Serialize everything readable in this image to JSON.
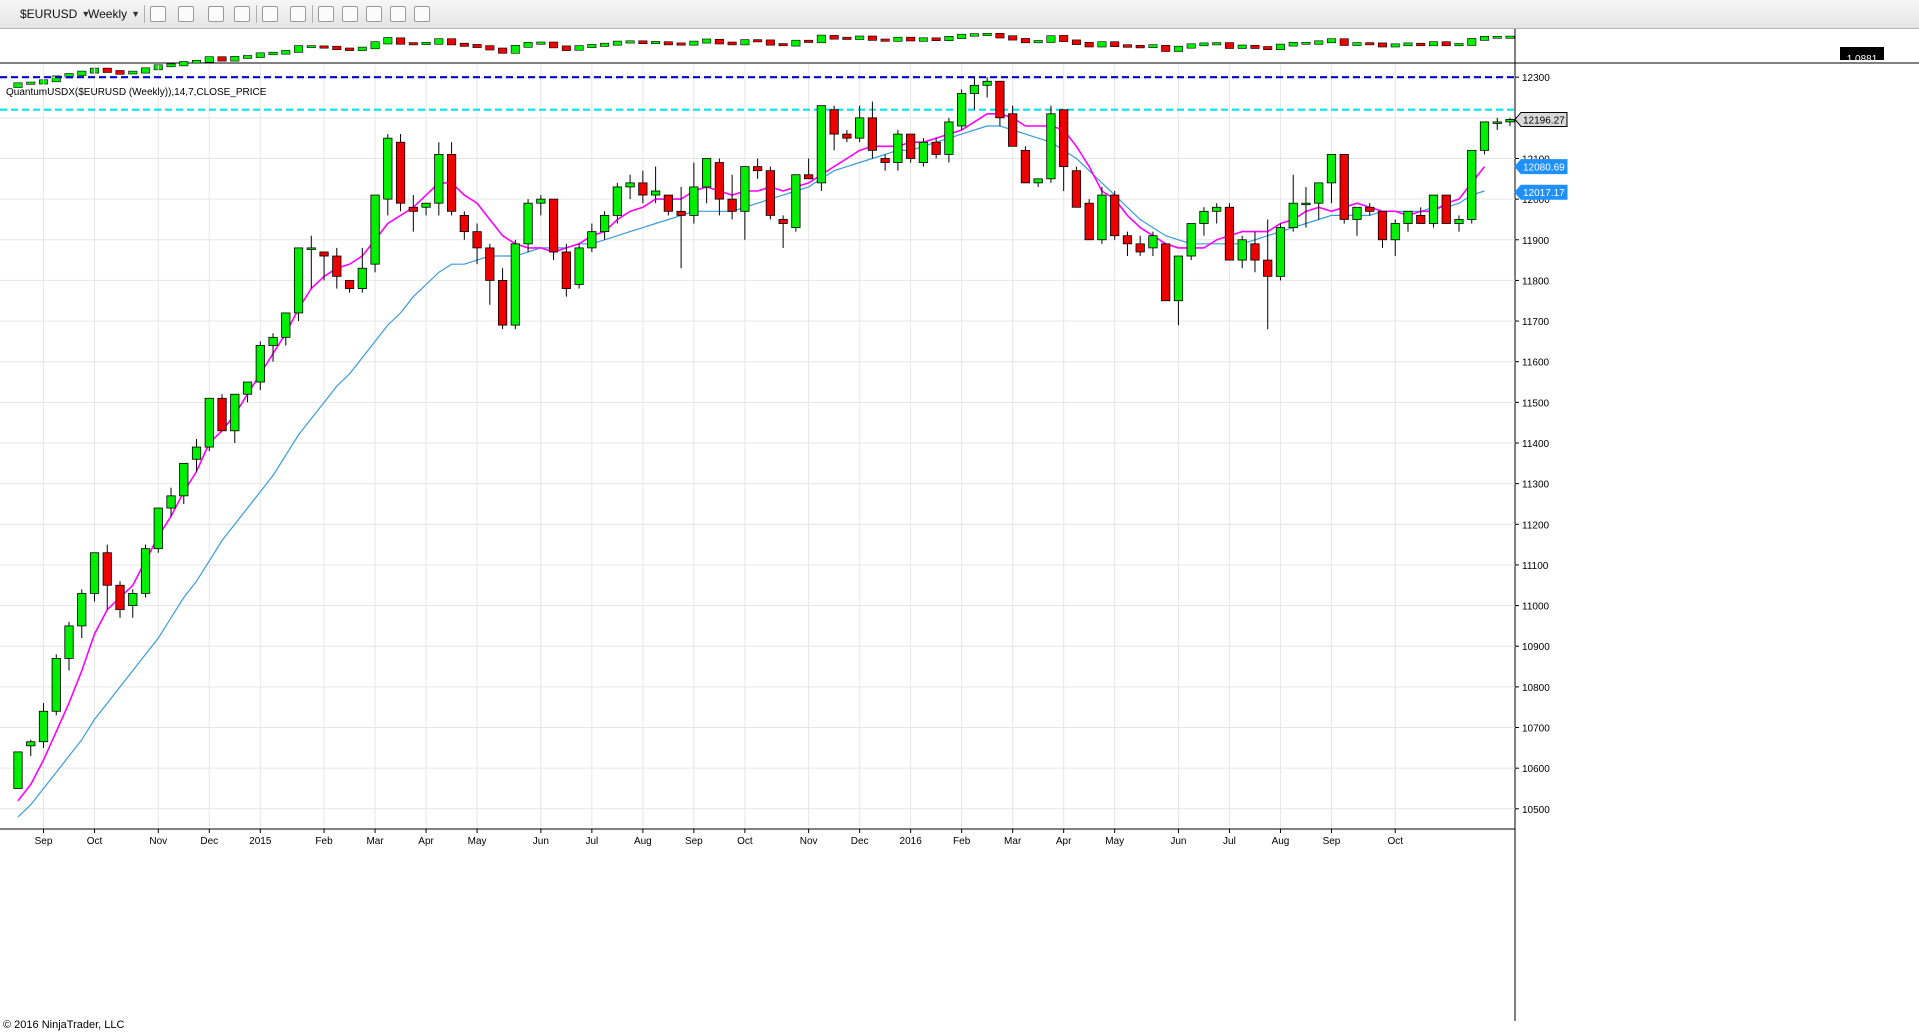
{
  "toolbar": {
    "instrument": "$EURUSD",
    "period": "Weekly"
  },
  "overview": {
    "price_badge": "1.0881"
  },
  "indicator_label": "QuantumUSDX($EURUSD (Weekly)),14,7,CLOSE_PRICE",
  "copyright": "© 2016 NinjaTrader, LLC",
  "colors": {
    "up": "#00ee00",
    "down": "#ee0000",
    "ema_fast": "#ff00ff",
    "ema_slow": "#3a9bdc",
    "resistance_1": "#0000cc",
    "resistance_2": "#00e5ee",
    "price_tag": "#1e90ff"
  },
  "chart_data": {
    "type": "candlestick",
    "ylim": [
      10470,
      12330
    ],
    "y_ticks": [
      "12300",
      "12200",
      "12100",
      "12000",
      "11900",
      "11800",
      "11700",
      "11600",
      "11500",
      "11400",
      "11300",
      "11200",
      "11100",
      "11000",
      "10900",
      "10800",
      "10700",
      "10600",
      "10500"
    ],
    "x_labels": [
      "Sep",
      "Oct",
      "Nov",
      "Dec",
      "2015",
      "Feb",
      "Mar",
      "Apr",
      "May",
      "Jun",
      "Jul",
      "Aug",
      "Sep",
      "Oct",
      "Nov",
      "Dec",
      "2016",
      "Feb",
      "Mar",
      "Apr",
      "May",
      "Jun",
      "Jul",
      "Aug",
      "Sep",
      "Oct"
    ],
    "x_label_bars": [
      2,
      6,
      11,
      15,
      19,
      24,
      28,
      32,
      36,
      41,
      45,
      49,
      53,
      57,
      62,
      66,
      70,
      74,
      78,
      82,
      86,
      91,
      95,
      99,
      103,
      108
    ],
    "resistance_levels": [
      12300,
      12220
    ],
    "price_tags": [
      {
        "label": "12196.27",
        "value": 12196,
        "style": "current"
      },
      {
        "label": "12080.69",
        "value": 12080,
        "style": "blue"
      },
      {
        "label": "12017.17",
        "value": 12017,
        "style": "blue"
      }
    ],
    "candles": [
      [
        10550,
        10640,
        10550,
        10640
      ],
      [
        10655,
        10670,
        10630,
        10665
      ],
      [
        10665,
        10760,
        10650,
        10740
      ],
      [
        10740,
        10880,
        10730,
        10870
      ],
      [
        10870,
        10960,
        10840,
        10950
      ],
      [
        10950,
        11040,
        10920,
        11030
      ],
      [
        11030,
        11130,
        11010,
        11130
      ],
      [
        11130,
        11150,
        10990,
        11050
      ],
      [
        11050,
        11060,
        10970,
        10990
      ],
      [
        11000,
        11040,
        10970,
        11030
      ],
      [
        11030,
        11150,
        11020,
        11140
      ],
      [
        11140,
        11240,
        11130,
        11240
      ],
      [
        11240,
        11290,
        11220,
        11270
      ],
      [
        11270,
        11340,
        11250,
        11350
      ],
      [
        11360,
        11410,
        11330,
        11390
      ],
      [
        11390,
        11510,
        11380,
        11510
      ],
      [
        11510,
        11520,
        11430,
        11430
      ],
      [
        11430,
        11520,
        11400,
        11520
      ],
      [
        11520,
        11550,
        11500,
        11550
      ],
      [
        11550,
        11650,
        11530,
        11640
      ],
      [
        11640,
        11670,
        11600,
        11660
      ],
      [
        11660,
        11720,
        11640,
        11720
      ],
      [
        11720,
        11880,
        11700,
        11880
      ],
      [
        11880,
        11910,
        11780,
        11880
      ],
      [
        11870,
        11870,
        11800,
        11860
      ],
      [
        11860,
        11880,
        11780,
        11810
      ],
      [
        11800,
        11800,
        11770,
        11780
      ],
      [
        11780,
        11880,
        11770,
        11830
      ],
      [
        11840,
        12010,
        11820,
        12010
      ],
      [
        12000,
        12160,
        11960,
        12150
      ],
      [
        12140,
        12160,
        11970,
        11990
      ],
      [
        11980,
        12010,
        11920,
        11970
      ],
      [
        11980,
        11990,
        11960,
        11990
      ],
      [
        11990,
        12140,
        11960,
        12110
      ],
      [
        12110,
        12140,
        11960,
        11970
      ],
      [
        11960,
        11970,
        11900,
        11920
      ],
      [
        11920,
        11940,
        11840,
        11880
      ],
      [
        11880,
        11890,
        11740,
        11800
      ],
      [
        11800,
        11830,
        11680,
        11690
      ],
      [
        11690,
        11900,
        11680,
        11890
      ],
      [
        11890,
        12000,
        11870,
        11990
      ],
      [
        11990,
        12010,
        11960,
        12000
      ],
      [
        12000,
        12000,
        11850,
        11870
      ],
      [
        11870,
        11890,
        11760,
        11780
      ],
      [
        11790,
        11890,
        11780,
        11880
      ],
      [
        11880,
        11940,
        11870,
        11920
      ],
      [
        11920,
        11970,
        11900,
        11960
      ],
      [
        11960,
        12040,
        11940,
        12030
      ],
      [
        12030,
        12060,
        12000,
        12040
      ],
      [
        12040,
        12070,
        11990,
        12010
      ],
      [
        12010,
        12080,
        11990,
        12020
      ],
      [
        12010,
        12010,
        11960,
        11970
      ],
      [
        11970,
        12030,
        11830,
        11960
      ],
      [
        11960,
        12090,
        11940,
        12030
      ],
      [
        12030,
        12090,
        11990,
        12100
      ],
      [
        12090,
        12100,
        11960,
        12000
      ],
      [
        12000,
        12060,
        11950,
        11970
      ],
      [
        11970,
        12080,
        11900,
        12080
      ],
      [
        12080,
        12100,
        12050,
        12070
      ],
      [
        12070,
        12080,
        11950,
        11960
      ],
      [
        11950,
        11960,
        11880,
        11940
      ],
      [
        11930,
        12050,
        11920,
        12060
      ],
      [
        12060,
        12100,
        12050,
        12050
      ],
      [
        12040,
        12230,
        12020,
        12230
      ],
      [
        12220,
        12230,
        12120,
        12160
      ],
      [
        12160,
        12170,
        12140,
        12150
      ],
      [
        12150,
        12230,
        12140,
        12200
      ],
      [
        12200,
        12240,
        12100,
        12120
      ],
      [
        12100,
        12110,
        12070,
        12090
      ],
      [
        12090,
        12170,
        12070,
        12160
      ],
      [
        12160,
        12160,
        12090,
        12100
      ],
      [
        12090,
        12150,
        12080,
        12140
      ],
      [
        12140,
        12150,
        12100,
        12110
      ],
      [
        12110,
        12200,
        12090,
        12190
      ],
      [
        12180,
        12270,
        12170,
        12260
      ],
      [
        12260,
        12300,
        12220,
        12280
      ],
      [
        12280,
        12300,
        12250,
        12290
      ],
      [
        12290,
        12290,
        12180,
        12200
      ],
      [
        12210,
        12230,
        12130,
        12130
      ],
      [
        12120,
        12130,
        12050,
        12040
      ],
      [
        12040,
        12050,
        12030,
        12050
      ],
      [
        12050,
        12230,
        12040,
        12210
      ],
      [
        12220,
        12220,
        12020,
        12080
      ],
      [
        12070,
        12080,
        11990,
        11980
      ],
      [
        11990,
        12000,
        11900,
        11900
      ],
      [
        11900,
        12030,
        11890,
        12010
      ],
      [
        12010,
        12020,
        11900,
        11910
      ],
      [
        11910,
        11920,
        11860,
        11890
      ],
      [
        11890,
        11910,
        11860,
        11870
      ],
      [
        11880,
        11920,
        11860,
        11910
      ],
      [
        11890,
        11890,
        11760,
        11750
      ],
      [
        11750,
        11860,
        11690,
        11860
      ],
      [
        11860,
        11940,
        11850,
        11940
      ],
      [
        11940,
        11980,
        11910,
        11970
      ],
      [
        11970,
        11990,
        11940,
        11980
      ],
      [
        11980,
        11990,
        11880,
        11850
      ],
      [
        11850,
        11910,
        11830,
        11900
      ],
      [
        11890,
        11920,
        11820,
        11850
      ],
      [
        11850,
        11950,
        11680,
        11810
      ],
      [
        11810,
        11940,
        11800,
        11930
      ],
      [
        11930,
        12060,
        11920,
        11990
      ],
      [
        11990,
        12030,
        11930,
        11990
      ],
      [
        11990,
        12040,
        11950,
        12040
      ],
      [
        12040,
        12110,
        11990,
        12110
      ],
      [
        12110,
        12110,
        11940,
        11950
      ],
      [
        11950,
        11980,
        11910,
        11980
      ],
      [
        11980,
        11990,
        11960,
        11970
      ],
      [
        11970,
        11970,
        11880,
        11900
      ],
      [
        11900,
        11950,
        11860,
        11940
      ],
      [
        11940,
        11950,
        11920,
        11970
      ],
      [
        11960,
        11980,
        11940,
        11940
      ],
      [
        11940,
        12010,
        11930,
        12010
      ],
      [
        12010,
        12010,
        11940,
        11940
      ],
      [
        11940,
        11960,
        11920,
        11950
      ],
      [
        11950,
        12100,
        11940,
        12120
      ],
      [
        12120,
        12190,
        12110,
        12190
      ],
      [
        12190,
        12200,
        12170,
        12190
      ],
      [
        12190,
        12200,
        12180,
        12196
      ]
    ],
    "ema_fast": [
      10520,
      10560,
      10620,
      10690,
      10760,
      10840,
      10930,
      10990,
      11020,
      11050,
      11110,
      11170,
      11220,
      11280,
      11330,
      11400,
      11430,
      11470,
      11520,
      11570,
      11620,
      11670,
      11730,
      11780,
      11810,
      11830,
      11840,
      11860,
      11900,
      11940,
      11960,
      11980,
      12010,
      12040,
      12040,
      12010,
      11990,
      11950,
      11910,
      11890,
      11880,
      11880,
      11870,
      11880,
      11890,
      11910,
      11920,
      11950,
      11970,
      11980,
      12000,
      12000,
      12000,
      12020,
      12030,
      12020,
      12010,
      12020,
      12020,
      12030,
      12020,
      12030,
      12040,
      12060,
      12080,
      12100,
      12120,
      12130,
      12130,
      12130,
      12140,
      12140,
      12150,
      12160,
      12170,
      12190,
      12210,
      12210,
      12200,
      12180,
      12180,
      12180,
      12170,
      12130,
      12080,
      12020,
      12000,
      11960,
      11930,
      11910,
      11890,
      11880,
      11880,
      11880,
      11900,
      11910,
      11920,
      11920,
      11920,
      11940,
      11950,
      11970,
      11980,
      11970,
      11980,
      11990,
      11980,
      11970,
      11970,
      11960,
      11970,
      11970,
      11990,
      12000,
      12040,
      12080
    ],
    "ema_slow": [
      10480,
      10510,
      10550,
      10590,
      10630,
      10670,
      10720,
      10760,
      10800,
      10840,
      10880,
      10920,
      10970,
      11020,
      11060,
      11110,
      11160,
      11200,
      11240,
      11280,
      11320,
      11370,
      11420,
      11460,
      11500,
      11540,
      11570,
      11610,
      11650,
      11690,
      11720,
      11760,
      11790,
      11820,
      11840,
      11840,
      11850,
      11860,
      11860,
      11860,
      11870,
      11880,
      11880,
      11880,
      11890,
      11890,
      11900,
      11910,
      11920,
      11930,
      11940,
      11950,
      11960,
      11970,
      11970,
      11970,
      11970,
      11980,
      11990,
      12000,
      12010,
      12020,
      12030,
      12050,
      12070,
      12080,
      12090,
      12100,
      12110,
      12120,
      12120,
      12130,
      12140,
      12150,
      12160,
      12170,
      12180,
      12180,
      12170,
      12160,
      12150,
      12140,
      12120,
      12100,
      12070,
      12040,
      12010,
      11980,
      11950,
      11930,
      11910,
      11900,
      11890,
      11890,
      11890,
      11890,
      11890,
      11900,
      11910,
      11920,
      11930,
      11940,
      11950,
      11960,
      11960,
      11960,
      11960,
      11970,
      11970,
      11970,
      11970,
      11980,
      11980,
      11990,
      12010,
      12020
    ]
  }
}
